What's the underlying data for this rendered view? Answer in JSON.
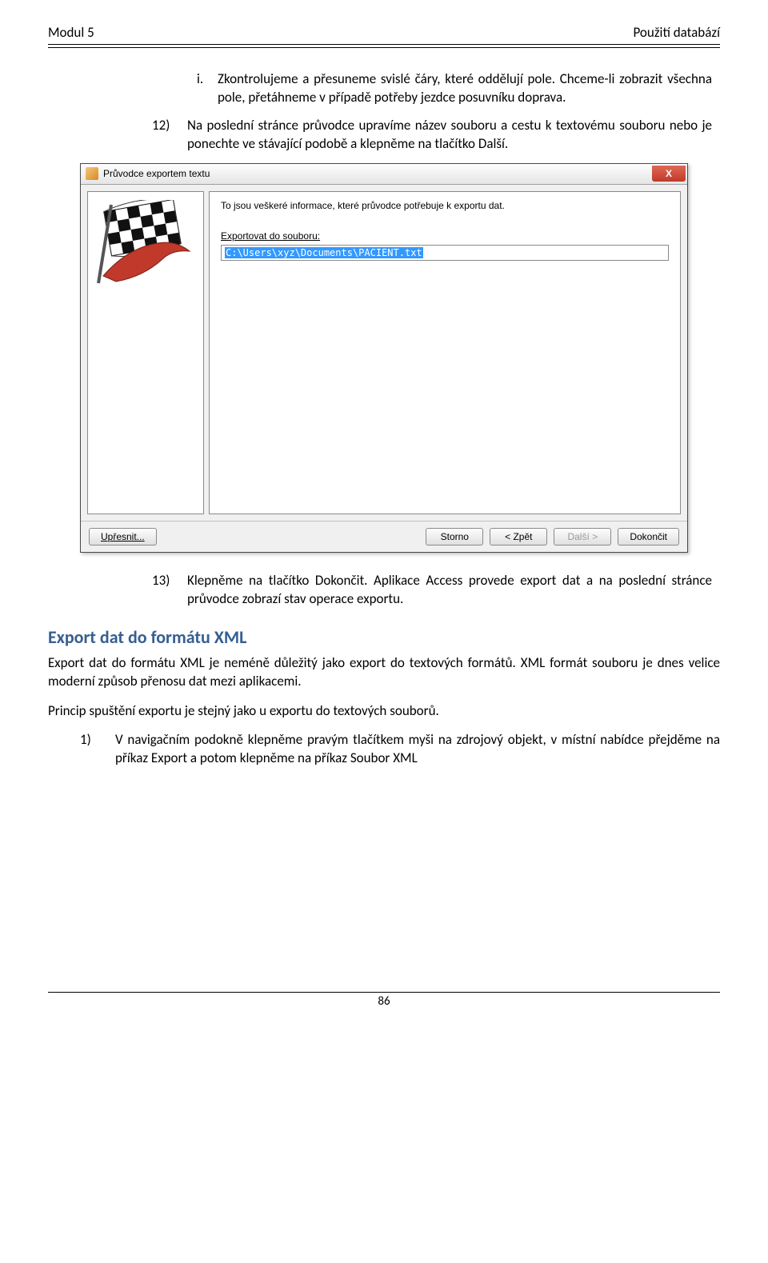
{
  "header": {
    "left": "Modul 5",
    "right": "Použití databází"
  },
  "item_i": {
    "num": "i.",
    "text": "Zkontrolujeme a přesuneme svislé čáry, které oddělují pole. Chceme-li zobrazit všechna pole, přetáhneme v případě potřeby jezdce posuvníku doprava."
  },
  "item_12": {
    "num": "12)",
    "text": "Na poslední stránce průvodce upravíme název souboru a cestu k textovému souboru nebo je ponechte ve stávající podobě a klepněme na tlačítko Další."
  },
  "wizard": {
    "title": "Průvodce exportem textu",
    "close": "X",
    "info": "To jsou veškeré informace, které průvodce potřebuje k exportu dat.",
    "export_label": "Exportovat do souboru:",
    "path": "C:\\Users\\xyz\\Documents\\PACIENT.txt",
    "btn_advanced": "Upřesnit...",
    "btn_cancel": "Storno",
    "btn_back": "< Zpět",
    "btn_next": "Další >",
    "btn_finish": "Dokončit"
  },
  "item_13": {
    "num": "13)",
    "text": "Klepněme na tlačítko Dokončit. Aplikace Access provede export dat a na poslední stránce průvodce zobrazí stav operace exportu."
  },
  "h_xml": "Export dat do formátu XML",
  "p_xml_1": "Export dat do formátu XML je neméně důležitý jako export do textových formátů. XML formát souboru je dnes velice moderní způsob přenosu dat mezi aplikacemi.",
  "p_xml_2": "Princip spuštění exportu je stejný jako u exportu do textových souborů.",
  "item_1": {
    "num": "1)",
    "text": "V navigačním podokně klepněme pravým tlačítkem myši na zdrojový objekt, v místní nabídce přejděme na příkaz Export a potom klepněme na příkaz Soubor XML"
  },
  "page_num": "86"
}
